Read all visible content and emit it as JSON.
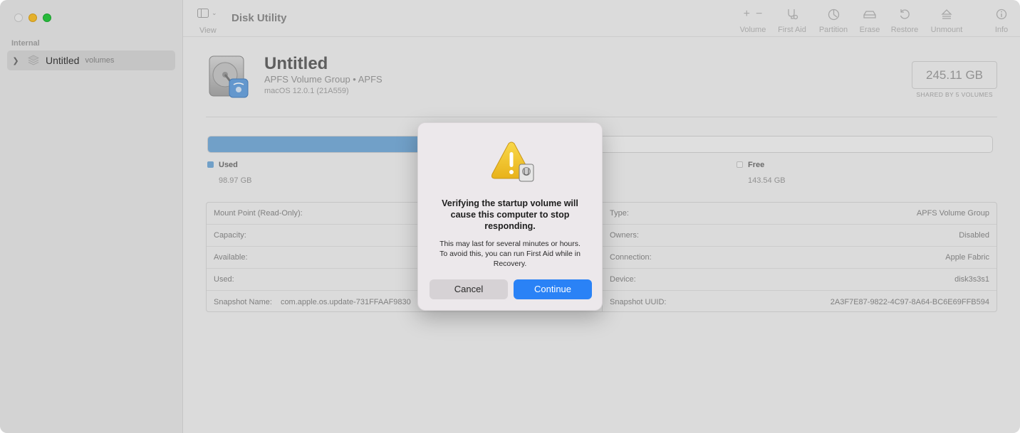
{
  "window": {
    "app_title": "Disk Utility"
  },
  "sidebar": {
    "section": "Internal",
    "items": [
      {
        "label": "Untitled",
        "sublabel": "volumes"
      }
    ]
  },
  "toolbar": {
    "view_label": "View",
    "buttons": [
      {
        "label": "Volume",
        "icon": "plus-minus-icon"
      },
      {
        "label": "First Aid",
        "icon": "stethoscope-icon"
      },
      {
        "label": "Partition",
        "icon": "partition-icon"
      },
      {
        "label": "Erase",
        "icon": "erase-icon"
      },
      {
        "label": "Restore",
        "icon": "restore-icon"
      },
      {
        "label": "Unmount",
        "icon": "eject-icon"
      },
      {
        "label": "Info",
        "icon": "info-icon"
      }
    ]
  },
  "volume": {
    "name": "Untitled",
    "type": "APFS Volume Group • APFS",
    "os": "macOS 12.0.1 (21A559)",
    "size": "245.11 GB",
    "shared": "SHARED BY 5 VOLUMES"
  },
  "usage": {
    "used_label": "Used",
    "used_value": "98.97 GB",
    "free_label": "Free",
    "free_value": "143.54 GB",
    "used_fraction": 0.4038,
    "used_color": "#7aadd8",
    "free_color": "#f2f2f2"
  },
  "info": {
    "left": [
      {
        "key": "Mount Point (Read-Only):",
        "value": ""
      },
      {
        "key": "Capacity:",
        "value": ""
      },
      {
        "key": "Available:",
        "value": ""
      },
      {
        "key": "Used:",
        "value": ""
      },
      {
        "key": "Snapshot Name:",
        "value": "com.apple.os.update-731FFAAF9830"
      }
    ],
    "right": [
      {
        "key": "Type:",
        "value": "APFS Volume Group"
      },
      {
        "key": "Owners:",
        "value": "Disabled"
      },
      {
        "key": "Connection:",
        "value": "Apple Fabric"
      },
      {
        "key": "Device:",
        "value": "disk3s3s1"
      },
      {
        "key": "Snapshot UUID:",
        "value": "2A3F7E87-9822-4C97-8A64-BC6E69FFB594"
      }
    ]
  },
  "alert": {
    "title": "Verifying the startup volume will cause this computer to stop responding.",
    "message": "This may last for several minutes or hours. To avoid this, you can run First Aid while in Recovery.",
    "cancel_label": "Cancel",
    "continue_label": "Continue",
    "accent": "#2a82f6"
  }
}
